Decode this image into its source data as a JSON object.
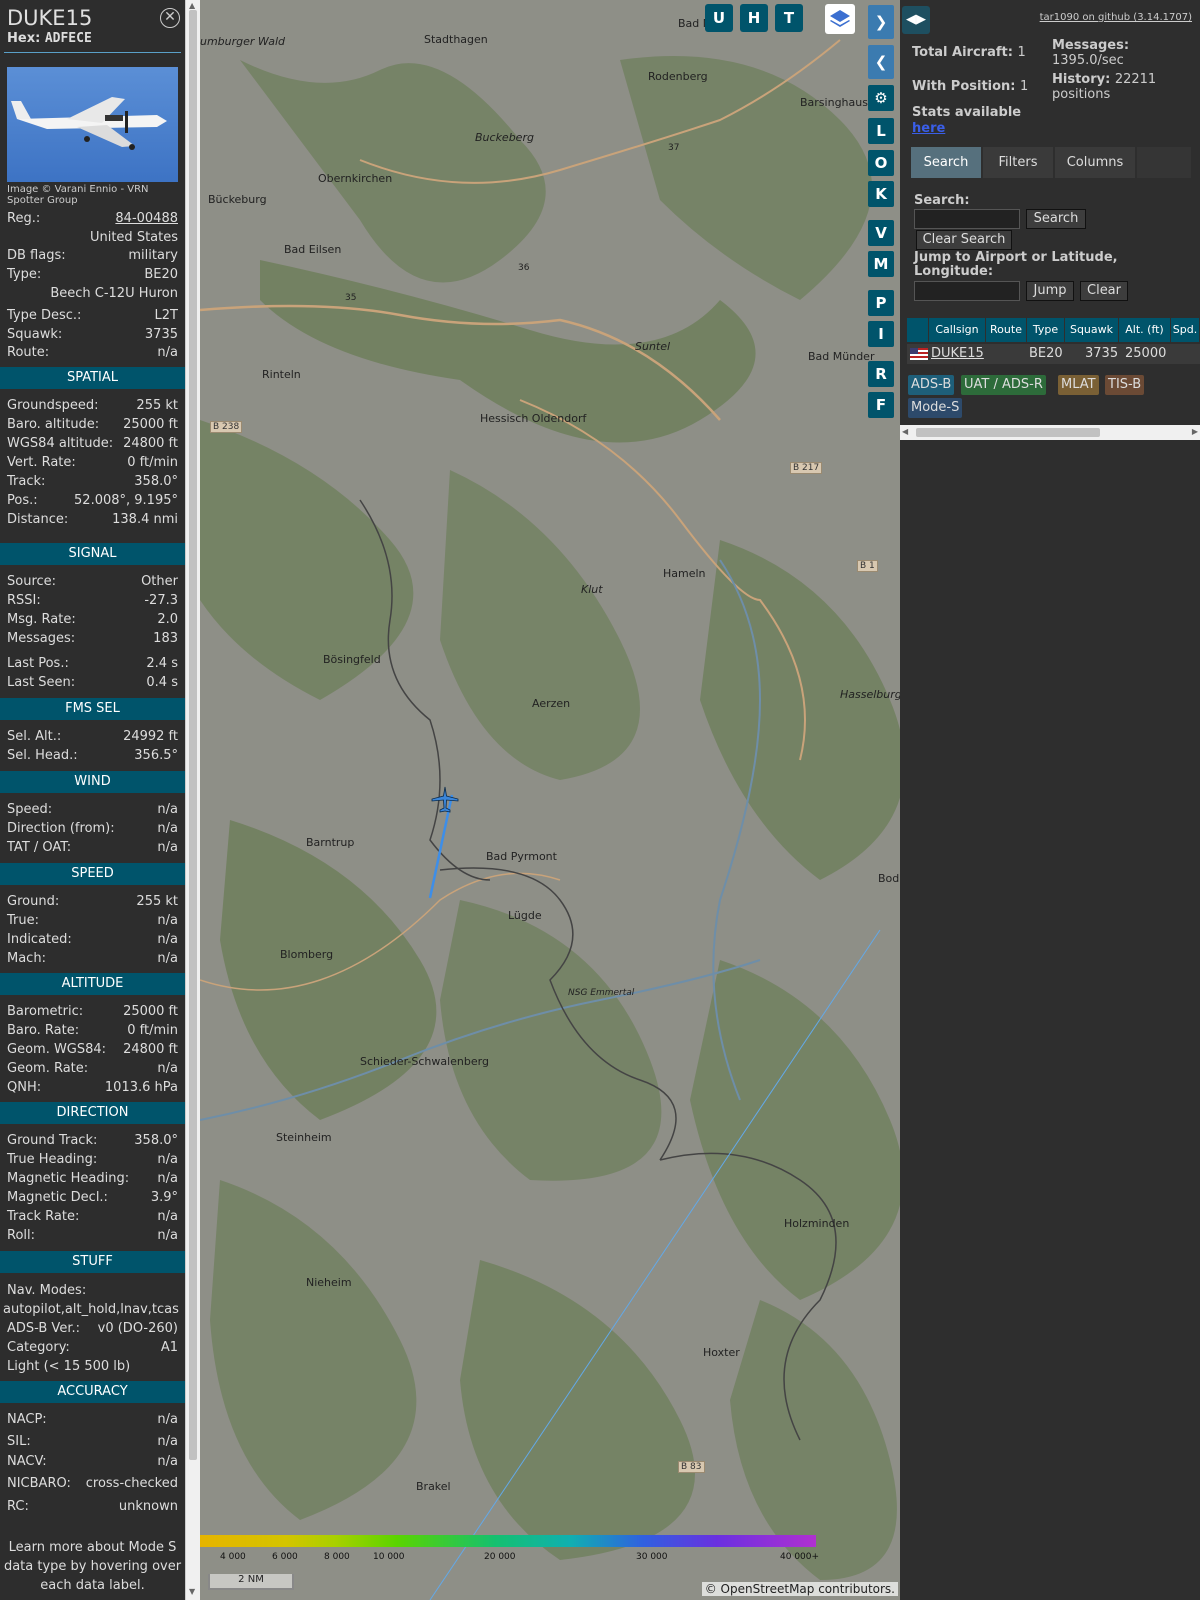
{
  "info": {
    "title": "DUKE15",
    "hex_label": "Hex:",
    "hex": "ADFECE",
    "close_icon": "close-icon",
    "image_credit": "Image © Varani Ennio - VRN Spotter Group",
    "rows_a": [
      {
        "l": "Reg.:",
        "v": "84-00488"
      },
      {
        "l": "",
        "v": "United States"
      },
      {
        "l": "DB flags:",
        "v": "military"
      },
      {
        "l": "Type:",
        "v": "BE20"
      },
      {
        "l": "",
        "v": "Beech C-12U Huron"
      },
      {
        "l": "Type Desc.:",
        "v": "L2T"
      },
      {
        "l": "Squawk:",
        "v": "3735"
      },
      {
        "l": "Route:",
        "v": "n/a"
      }
    ],
    "spatial_title": "SPATIAL",
    "spatial": [
      {
        "l": "Groundspeed:",
        "v": "255 kt"
      },
      {
        "l": "Baro. altitude:",
        "v": "25000 ft"
      },
      {
        "l": "WGS84 altitude:",
        "v": "24800 ft"
      },
      {
        "l": "Vert. Rate:",
        "v": "0 ft/min"
      },
      {
        "l": "Track:",
        "v": "358.0°"
      },
      {
        "l": "Pos.:",
        "v": "52.008°, 9.195°"
      },
      {
        "l": "Distance:",
        "v": "138.4 nmi"
      }
    ],
    "signal_title": "SIGNAL",
    "signal": [
      {
        "l": "Source:",
        "v": "Other"
      },
      {
        "l": "RSSI:",
        "v": "-27.3"
      },
      {
        "l": "Msg. Rate:",
        "v": "2.0"
      },
      {
        "l": "Messages:",
        "v": "183"
      },
      {
        "l": "Last Pos.:",
        "v": "2.4 s"
      },
      {
        "l": "Last Seen:",
        "v": "0.4 s"
      }
    ],
    "fms_title": "FMS SEL",
    "fms": [
      {
        "l": "Sel. Alt.:",
        "v": "24992 ft"
      },
      {
        "l": "Sel. Head.:",
        "v": "356.5°"
      }
    ],
    "wind_title": "WIND",
    "wind": [
      {
        "l": "Speed:",
        "v": "n/a"
      },
      {
        "l": "Direction (from):",
        "v": "n/a"
      },
      {
        "l": "TAT / OAT:",
        "v": "n/a"
      }
    ],
    "speed_title": "SPEED",
    "speed": [
      {
        "l": "Ground:",
        "v": "255 kt"
      },
      {
        "l": "True:",
        "v": "n/a"
      },
      {
        "l": "Indicated:",
        "v": "n/a"
      },
      {
        "l": "Mach:",
        "v": "n/a"
      }
    ],
    "altitude_title": "ALTITUDE",
    "altitude": [
      {
        "l": "Barometric:",
        "v": "25000 ft"
      },
      {
        "l": "Baro. Rate:",
        "v": "0 ft/min"
      },
      {
        "l": "Geom. WGS84:",
        "v": "24800 ft"
      },
      {
        "l": "Geom. Rate:",
        "v": "n/a"
      },
      {
        "l": "QNH:",
        "v": "1013.6 hPa"
      }
    ],
    "direction_title": "DIRECTION",
    "direction": [
      {
        "l": "Ground Track:",
        "v": "358.0°"
      },
      {
        "l": "True Heading:",
        "v": "n/a"
      },
      {
        "l": "Magnetic Heading:",
        "v": "n/a"
      },
      {
        "l": "Magnetic Decl.:",
        "v": "3.9°"
      },
      {
        "l": "Track Rate:",
        "v": "n/a"
      },
      {
        "l": "Roll:",
        "v": "n/a"
      }
    ],
    "stuff_title": "STUFF",
    "nav_modes_label": "Nav. Modes:",
    "nav_modes": "autopilot,alt_hold,lnav,tcas",
    "adsb_ver_label": "ADS-B Ver.:",
    "adsb_ver": "v0 (DO-260)",
    "category_label": "Category:",
    "category": "A1",
    "category_desc": "Light (< 15 500 lb)",
    "accuracy_title": "ACCURACY",
    "accuracy": [
      {
        "l": "NACP:",
        "v": "n/a"
      },
      {
        "l": "SIL:",
        "v": "n/a"
      },
      {
        "l": "NACV:",
        "v": "n/a"
      },
      {
        "l": "NICBARO:",
        "v": "cross-checked"
      },
      {
        "l": "RC:",
        "v": "unknown"
      }
    ],
    "learn_more": "Learn more about Mode S data type by hovering over each data label."
  },
  "map": {
    "layer_buttons": [
      "U",
      "H",
      "T"
    ],
    "side_buttons": [
      "L",
      "O",
      "K",
      "V",
      "M",
      "P",
      "I",
      "R",
      "F"
    ],
    "places": [
      "Stadthagen",
      "Rodenberg",
      "Barsinghause",
      "Obernkirchen",
      "Buckeberg",
      "Bückeburg",
      "Bad Eilsen",
      "Suntel",
      "Bad Münder",
      "Rinteln",
      "Hessisch Oldendorf",
      "Klut",
      "Hameln",
      "Hasselburg",
      "Bösingfeld",
      "Aerzen",
      "Barntrup",
      "Bad Pyrmont",
      "Lügde",
      "Blomberg",
      "NSG Emmertal",
      "Schieder-Schwalenberg",
      "Steinheim",
      "Holzminden",
      "Nieheim",
      "Hoxter",
      "Brakel",
      "Bod",
      "Bad N",
      "umburger Wald"
    ],
    "roads": [
      "B 238",
      "B 217",
      "B 1",
      "B 83",
      "37",
      "36",
      "35"
    ],
    "color_scale_labels": [
      "4 000",
      "6 000",
      "8 000",
      "10 000",
      "20 000",
      "30 000",
      "40 000+"
    ],
    "scale_bar": "2 NM",
    "attribution": "© OpenStreetMap contributors."
  },
  "rp": {
    "github_link": "tar1090 on github (3.14.1707)",
    "total_aircraft_label": "Total Aircraft:",
    "total_aircraft": "1",
    "with_position_label": "With Position:",
    "with_position": "1",
    "messages_label": "Messages:",
    "messages": "1395.0/sec",
    "history_label": "History:",
    "history": "22211 positions",
    "stats_label": "Stats available",
    "stats_link": "here",
    "tabs": [
      "Search",
      "Filters",
      "Columns"
    ],
    "search_label": "Search:",
    "search_button": "Search",
    "clear_search_button": "Clear Search",
    "jump_label": "Jump to Airport or Latitude, Longitude:",
    "jump_button": "Jump",
    "clear_button": "Clear",
    "columns": [
      "Callsign",
      "Route",
      "Type",
      "Squawk",
      "Alt. (ft)",
      "Spd."
    ],
    "row": {
      "callsign": "DUKE15",
      "type": "BE20",
      "squawk": "3735",
      "alt": "25000"
    },
    "badges": [
      "ADS-B",
      "UAT / ADS-R",
      "MLAT",
      "TIS-B",
      "Mode-S"
    ],
    "colors": {
      "adsb": "#1e5f7a",
      "uat": "#2d6b3a",
      "mlat": "#7a6035",
      "tisb": "#6b4a35",
      "modes": "#2d4a6b"
    }
  }
}
